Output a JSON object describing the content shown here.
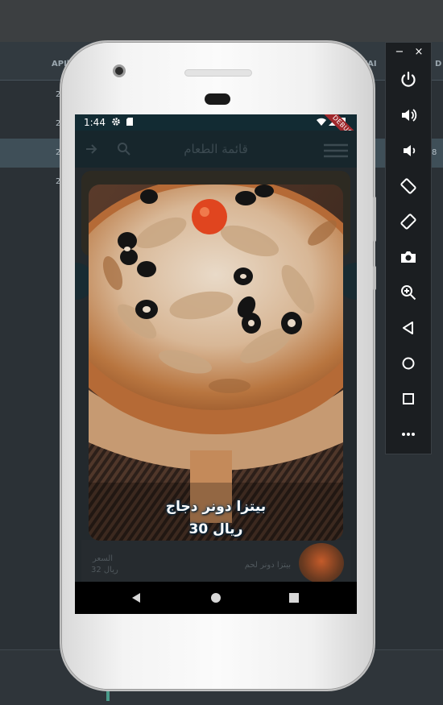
{
  "ide": {
    "column_left": "APIl",
    "column_right": "l/AI",
    "column_far_right": "D",
    "row_values": [
      "2",
      "2",
      "2",
      "2"
    ],
    "selected_row_right_value": "8"
  },
  "emulator_toolbar": {
    "minimize_label": "−",
    "close_label": "×",
    "buttons": [
      "power-icon",
      "volume-up-icon",
      "volume-down-icon",
      "rotate-left-icon",
      "rotate-right-icon",
      "camera-icon",
      "zoom-icon",
      "back-icon",
      "home-icon",
      "overview-icon",
      "more-icon"
    ]
  },
  "status_bar": {
    "time": "1:44",
    "debug_label": "DEBUG"
  },
  "app_bar": {
    "title": "قائمة الطعام"
  },
  "background_item": {
    "name": "بيتزا دونر لحم",
    "price_label": "السعر",
    "price": "32 ريال"
  },
  "dialog": {
    "item_name": "بيتزا دونر دجاج",
    "item_price": "30 ريال"
  },
  "colors": {
    "status_bar": "#122b33",
    "app_bar": "#17262c",
    "text_shadow": "#0b3b5e"
  }
}
